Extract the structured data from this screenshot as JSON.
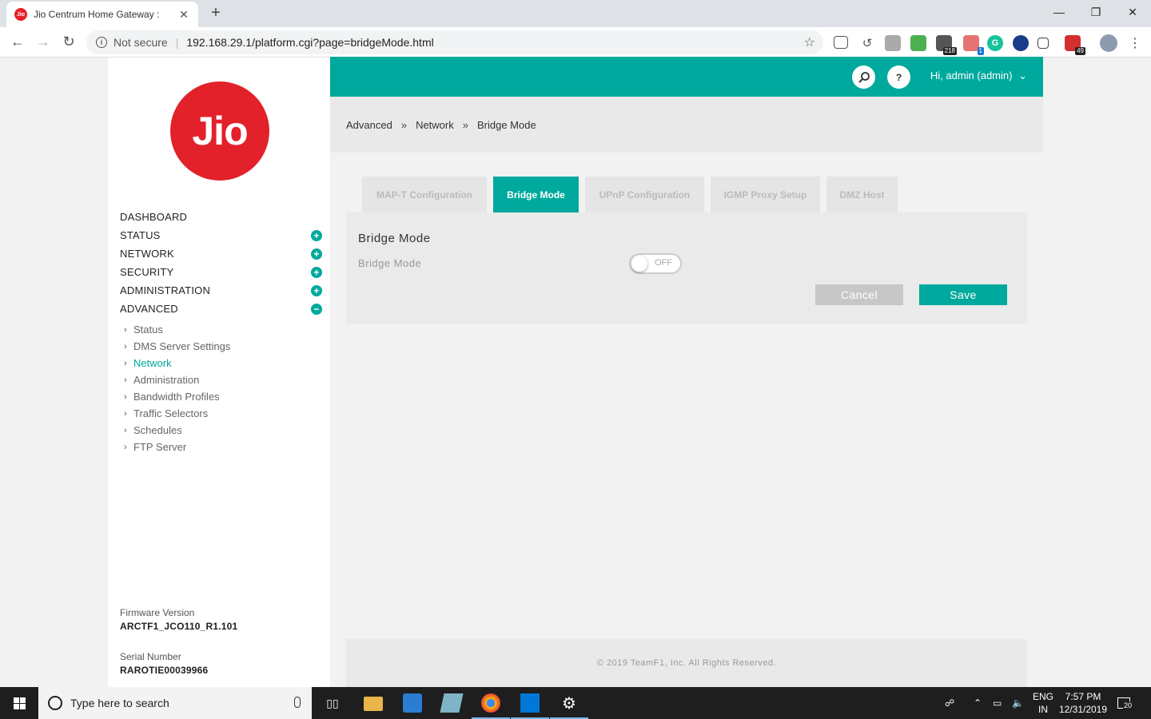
{
  "browser": {
    "tab_title": "Jio Centrum Home Gateway :",
    "favicon_text": "Jio",
    "not_secure": "Not secure",
    "url": "192.168.29.1/platform.cgi?page=bridgeMode.html",
    "ext_badge_1": "218",
    "ext_badge_2": "1",
    "ext_badge_3": "49"
  },
  "sidebar": {
    "logo_text": "Jio",
    "menu": [
      {
        "label": "DASHBOARD",
        "toggle": ""
      },
      {
        "label": "STATUS",
        "toggle": "+"
      },
      {
        "label": "NETWORK",
        "toggle": "+"
      },
      {
        "label": "SECURITY",
        "toggle": "+"
      },
      {
        "label": "ADMINISTRATION",
        "toggle": "+"
      },
      {
        "label": "ADVANCED",
        "toggle": "−"
      }
    ],
    "submenu": [
      "Status",
      "DMS Server Settings",
      "Network",
      "Administration",
      "Bandwidth Profiles",
      "Traffic Selectors",
      "Schedules",
      "FTP Server"
    ],
    "firmware_label": "Firmware Version",
    "firmware_value": "ARCTF1_JCO110_R1.101",
    "serial_label": "Serial Number",
    "serial_value": "RAROTIE00039966"
  },
  "header": {
    "help_label": "?",
    "user_label": "Hi, admin (admin)"
  },
  "breadcrumb": {
    "items": [
      "Advanced",
      "Network",
      "Bridge Mode"
    ],
    "separator": "»"
  },
  "tabs": [
    "MAP-T Configuration",
    "Bridge Mode",
    "UPnP Configuration",
    "IGMP Proxy Setup",
    "DMZ Host"
  ],
  "panel": {
    "title": "Bridge Mode",
    "field_label": "Bridge Mode",
    "toggle_state": "OFF",
    "cancel_label": "Cancel",
    "save_label": "Save"
  },
  "footer": {
    "copyright": "© 2019 TeamF1, Inc. All Rights Reserved."
  },
  "taskbar": {
    "search_placeholder": "Type here to search",
    "lang_top": "ENG",
    "lang_bottom": "IN",
    "time": "7:57 PM",
    "date": "12/31/2019",
    "notification_count": "20"
  },
  "colors": {
    "accent": "#00a99d",
    "brand_red": "#e2212a"
  }
}
